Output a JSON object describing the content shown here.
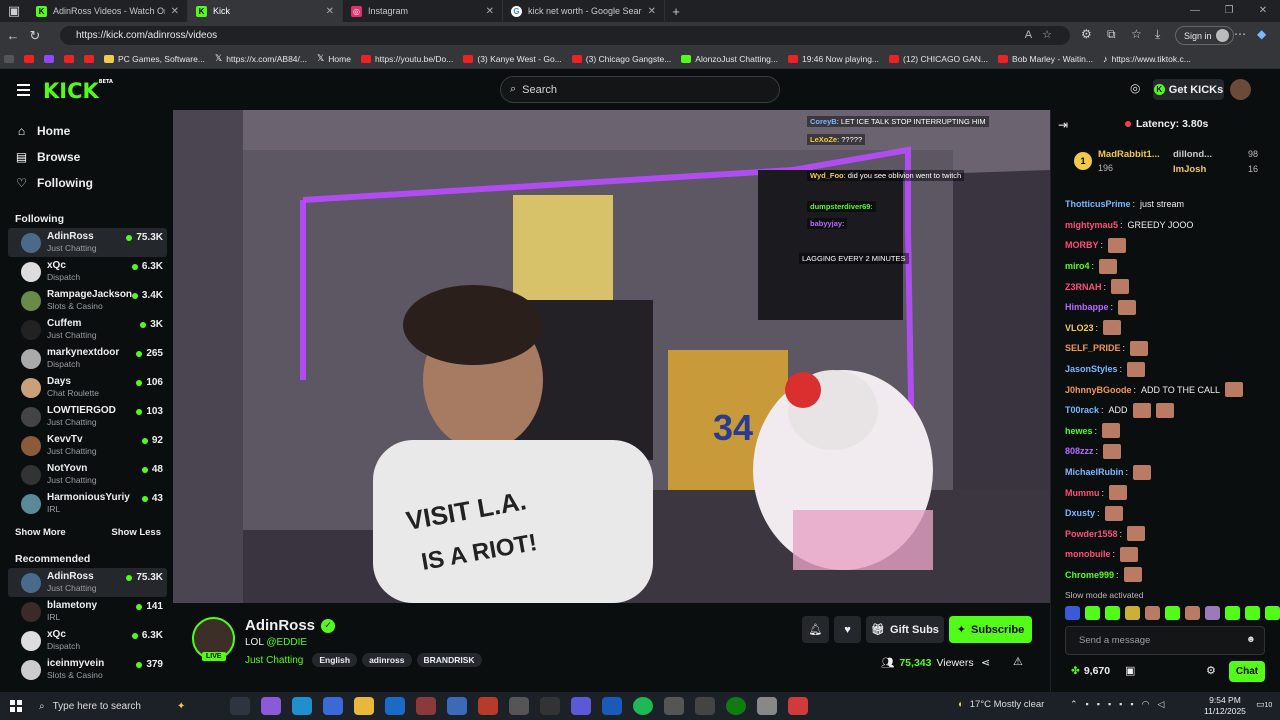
{
  "browser": {
    "tabs": [
      {
        "title": "AdinRoss Videos - Watch On",
        "icon": "kick-icon",
        "active": false
      },
      {
        "title": "Kick",
        "icon": "kick-icon",
        "active": true
      },
      {
        "title": "Instagram",
        "icon": "instagram-icon",
        "active": false
      },
      {
        "title": "kick net worth - Google Search",
        "icon": "google-icon",
        "active": false
      }
    ],
    "url": "https://kick.com/adinross/videos",
    "signin_label": "Sign in",
    "bookmarks": [
      "PC Games, Software...",
      "https://x.com/AB84/...",
      "Home",
      "https://youtu.be/Do...",
      "(3) Kanye West - Go...",
      "(3) Chicago Gangste...",
      "AlonzoJust Chatting...",
      "19:46 Now playing...",
      "(12) CHICAGO GAN...",
      "Bob Marley - Waitin...",
      "https://www.tiktok.c..."
    ]
  },
  "header": {
    "logo": "KICK",
    "logo_beta": "BETA",
    "search_placeholder": "Search",
    "get_kicks": "Get KICKs"
  },
  "sidebar": {
    "nav": [
      "Home",
      "Browse",
      "Following"
    ],
    "following_title": "Following",
    "following": [
      {
        "name": "AdinRoss",
        "category": "Just Chatting",
        "viewers": "75.3K",
        "color": "#4a6a8a"
      },
      {
        "name": "xQc",
        "category": "Dispatch",
        "viewers": "6.3K",
        "color": "#dddddd"
      },
      {
        "name": "RampageJackson",
        "category": "Slots & Casino",
        "viewers": "3.4K",
        "color": "#6a8a4a"
      },
      {
        "name": "Cuffem",
        "category": "Just Chatting",
        "viewers": "3K",
        "color": "#222222"
      },
      {
        "name": "markynextdoor",
        "category": "Dispatch",
        "viewers": "265",
        "color": "#aaaaaa"
      },
      {
        "name": "Days",
        "category": "Chat Roulette",
        "viewers": "106",
        "color": "#c9a07a"
      },
      {
        "name": "LOWTIERGOD",
        "category": "Just Chatting",
        "viewers": "103",
        "color": "#444444"
      },
      {
        "name": "KevvTv",
        "category": "Just Chatting",
        "viewers": "92",
        "color": "#8a5a3a"
      },
      {
        "name": "NotYovn",
        "category": "Just Chatting",
        "viewers": "48",
        "color": "#333333"
      },
      {
        "name": "HarmoniousYuriy",
        "category": "IRL",
        "viewers": "43",
        "color": "#5a8a9a"
      }
    ],
    "show_more": "Show More",
    "show_less": "Show Less",
    "recommended_title": "Recommended",
    "recommended": [
      {
        "name": "AdinRoss",
        "category": "Just Chatting",
        "viewers": "75.3K",
        "color": "#4a6a8a"
      },
      {
        "name": "blametony",
        "category": "IRL",
        "viewers": "141",
        "color": "#3a2a2a"
      },
      {
        "name": "xQc",
        "category": "Dispatch",
        "viewers": "6.3K",
        "color": "#dddddd"
      },
      {
        "name": "iceinmyvein",
        "category": "Slots & Casino",
        "viewers": "379",
        "color": "#cccccc"
      }
    ]
  },
  "video_overlay": [
    {
      "user": "CoreyB",
      "text": "LET ICE TALK STOP INTERRUPTING HIM"
    },
    {
      "user": "LeXoZe",
      "text": "?????"
    },
    {
      "user": "Wyd_Foo",
      "text": "did you see oblivion went to twitch"
    },
    {
      "user": "dumpsterdiver69",
      "text": ""
    },
    {
      "user": "babyyjay",
      "text": ""
    },
    {
      "user": "",
      "text": "LAGGING EVERY 2 MINUTES"
    }
  ],
  "stream": {
    "name": "AdinRoss",
    "live": "LIVE",
    "title": "LOL ",
    "mention": "@EDDIE",
    "category": "Just Chatting",
    "tags": [
      "English",
      "adinross",
      "BRANDRISK"
    ],
    "gift_label": "Gift Subs",
    "subscribe_label": "Subscribe",
    "viewers": "75,343",
    "viewers_label": "Viewers"
  },
  "chat": {
    "latency": "Latency: 3.80s",
    "gifters": [
      {
        "rank": "1",
        "name": "MadRabbit1...",
        "count": "196"
      },
      {
        "name": "dillond...",
        "count": "98"
      },
      {
        "name": "ImJosh",
        "count": "16"
      }
    ],
    "messages": [
      {
        "user": "ThotticusPrime",
        "color": "#7ab8ff",
        "text": "just stream",
        "emotes": 0
      },
      {
        "user": "mightymau5",
        "color": "#ff4d7a",
        "text": "GREEDY JOOO",
        "emotes": 0
      },
      {
        "user": "MORBY",
        "color": "#ff4d7a",
        "text": "",
        "emotes": 1
      },
      {
        "user": "miro4",
        "color": "#53fc18",
        "text": "",
        "emotes": 1
      },
      {
        "user": "Z3RNAH",
        "color": "#ff4d7a",
        "text": "",
        "emotes": 1
      },
      {
        "user": "Himbappe",
        "color": "#b46bff",
        "text": "",
        "emotes": 1
      },
      {
        "user": "VLO23",
        "color": "#f2c94c",
        "text": "",
        "emotes": 1
      },
      {
        "user": "SELF_PRIDE",
        "color": "#f2994a",
        "text": "",
        "emotes": 1
      },
      {
        "user": "JasonStyles",
        "color": "#7ab8ff",
        "text": "",
        "emotes": 1
      },
      {
        "user": "J0hnnyBGoode",
        "color": "#f2994a",
        "text": "ADD  TO THE CALL",
        "emotes": 1
      },
      {
        "user": "T00rack",
        "color": "#7ab8ff",
        "text": "ADD",
        "emotes": 2
      },
      {
        "user": "hewes",
        "color": "#53fc18",
        "text": "",
        "emotes": 1
      },
      {
        "user": "808zzz",
        "color": "#b46bff",
        "text": "",
        "emotes": 1
      },
      {
        "user": "MichaelRubin",
        "color": "#7ab8ff",
        "text": "",
        "emotes": 1
      },
      {
        "user": "Mummu",
        "color": "#ff4d7a",
        "text": "",
        "emotes": 1
      },
      {
        "user": "Dxusty",
        "color": "#7ab8ff",
        "text": "",
        "emotes": 1
      },
      {
        "user": "Powder1558",
        "color": "#ff4d7a",
        "text": "",
        "emotes": 1
      },
      {
        "user": "monobuile",
        "color": "#ff4d7a",
        "text": "",
        "emotes": 1
      },
      {
        "user": "Chrome999",
        "color": "#53fc18",
        "text": "",
        "emotes": 1
      }
    ],
    "slow_mode": "Slow mode activated",
    "send_placeholder": "Send a message",
    "points": "9,670",
    "chat_button": "Chat"
  },
  "taskbar": {
    "search_placeholder": "Type here to search",
    "weather": "17°C  Mostly clear",
    "time": "9:54 PM",
    "date": "11/12/2025",
    "notifications": "10"
  }
}
